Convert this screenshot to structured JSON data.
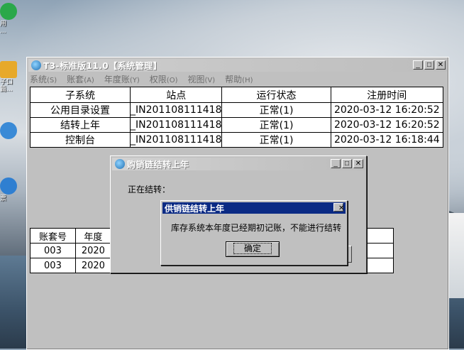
{
  "desktop": {
    "icons": [
      {
        "label": "用\n...",
        "color": "#2aa84a"
      },
      {
        "label": "子口\n篇...",
        "color": "#e7a92a"
      },
      {
        "label": "",
        "color": "#3a8ad6"
      },
      {
        "label": "票",
        "color": "#2f7fd1"
      }
    ]
  },
  "main_window": {
    "title": "T3-标准版11.0【系统管理】",
    "menu": [
      {
        "label": "系统",
        "accel": "(S)"
      },
      {
        "label": "账套",
        "accel": "(A)"
      },
      {
        "label": "年度账",
        "accel": "(Y)"
      },
      {
        "label": "权限",
        "accel": "(O)"
      },
      {
        "label": "视图",
        "accel": "(V)"
      },
      {
        "label": "帮助",
        "accel": "(H)"
      }
    ],
    "subsystem_table": {
      "headers": [
        "子系统",
        "站点",
        "运行状态",
        "注册时间"
      ],
      "rows": [
        [
          "公用目录设置",
          "_IN201108111418",
          "正常(1)",
          "2020-03-12 16:20:52"
        ],
        [
          "结转上年",
          "_IN201108111418",
          "正常(1)",
          "2020-03-12 16:20:52"
        ],
        [
          "控制台",
          "_IN201108111418",
          "正常(1)",
          "2020-03-12 16:18:44"
        ]
      ]
    },
    "account_table": {
      "headers": [
        "账套号",
        "年度"
      ],
      "rows": [
        [
          "003",
          "2020"
        ],
        [
          "003",
          "2020"
        ]
      ]
    }
  },
  "carry_dialog": {
    "title": "购销链结转上年",
    "progress_label": "正在结转："
  },
  "message_dialog": {
    "title": "供销链结转上年",
    "message": "库存系统本年度已经期初记账，不能进行结转",
    "ok_label": "确定"
  },
  "window_buttons": {
    "minimize": "_",
    "maximize": "□",
    "close": "✕"
  }
}
